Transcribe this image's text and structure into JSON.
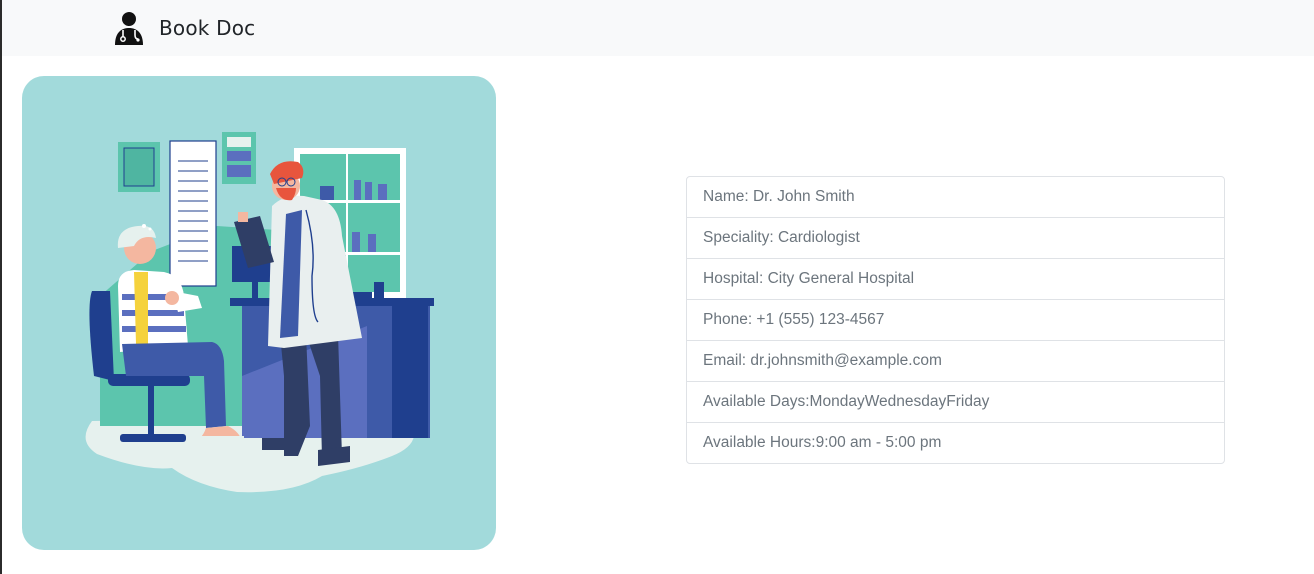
{
  "navbar": {
    "brand_icon": "doctor-icon",
    "brand_text": "Book Doc"
  },
  "illustration": {
    "icon": "doctor-patient-illustration",
    "colors": {
      "background": "#a2dadb",
      "teal": "#5cc5ad",
      "navy": "#1f3f8e",
      "accent_red": "#e8553d"
    }
  },
  "doctor": {
    "name": "Name: Dr. John Smith",
    "speciality": "Speciality: Cardiologist",
    "hospital": "Hospital: City General Hospital",
    "phone": "Phone: +1 (555) 123-4567",
    "email": "Email: dr.johnsmith@example.com",
    "available_days": "Available Days:MondayWednesdayFriday",
    "available_hours": "Available Hours:9:00 am - 5:00 pm"
  }
}
